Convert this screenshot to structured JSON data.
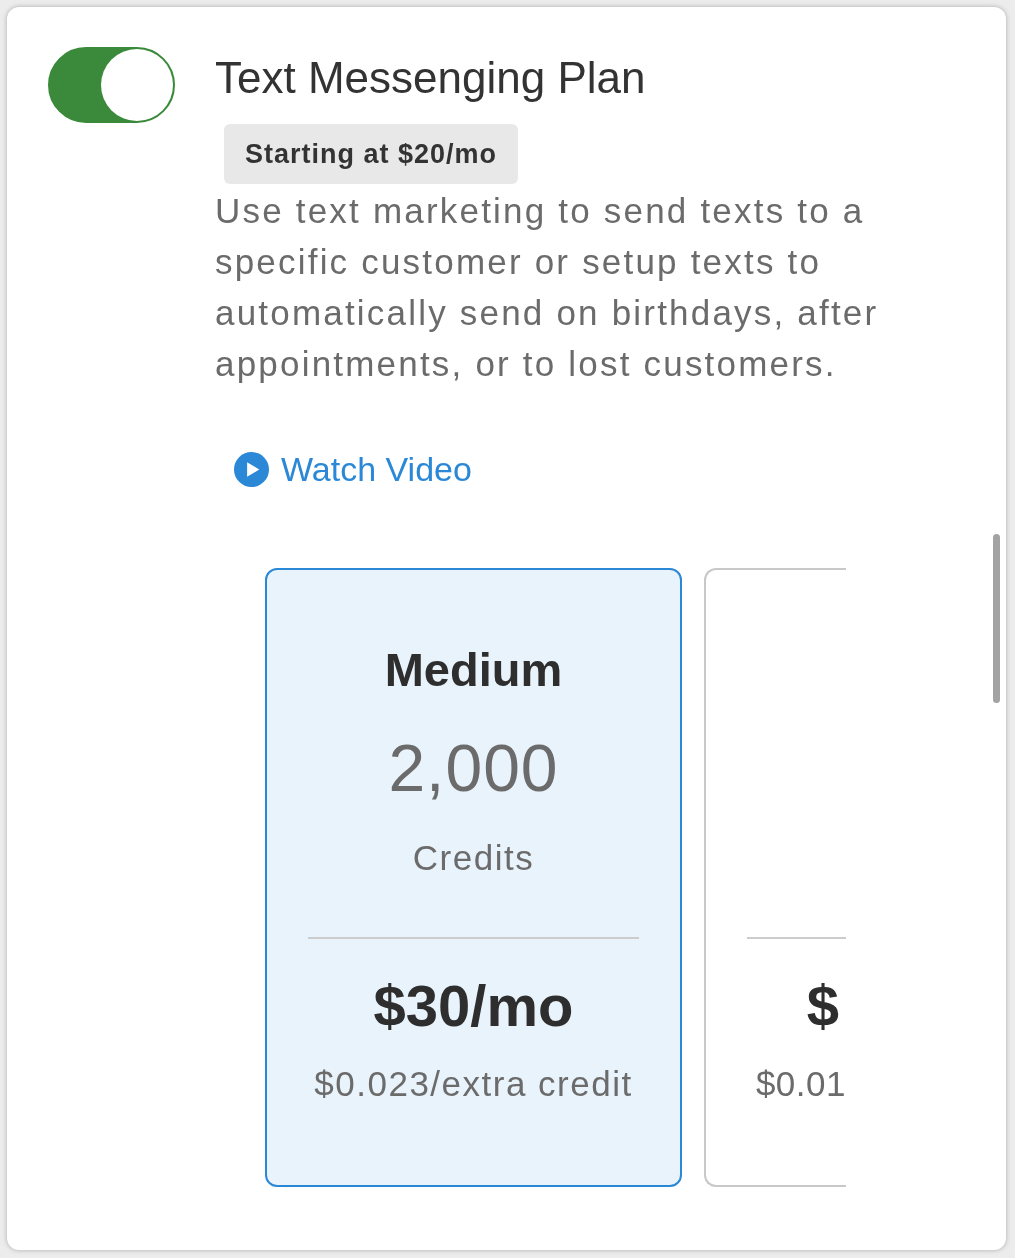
{
  "plan": {
    "enabled": true,
    "title": "Text Messenging Plan",
    "badge": "Starting at $20/mo",
    "description": "Use text marketing to send texts to a specific customer or setup texts to automatically send on birthdays, after appointments, or to lost customers.",
    "video_link": "Watch Video"
  },
  "tiers": [
    {
      "selected": true,
      "name": "Medium",
      "credits": "2,000",
      "unit": "Credits",
      "price": "$30/mo",
      "rate": "$0.023/extra credit"
    },
    {
      "selected": false,
      "price": "$",
      "rate": "$0.01"
    }
  ]
}
